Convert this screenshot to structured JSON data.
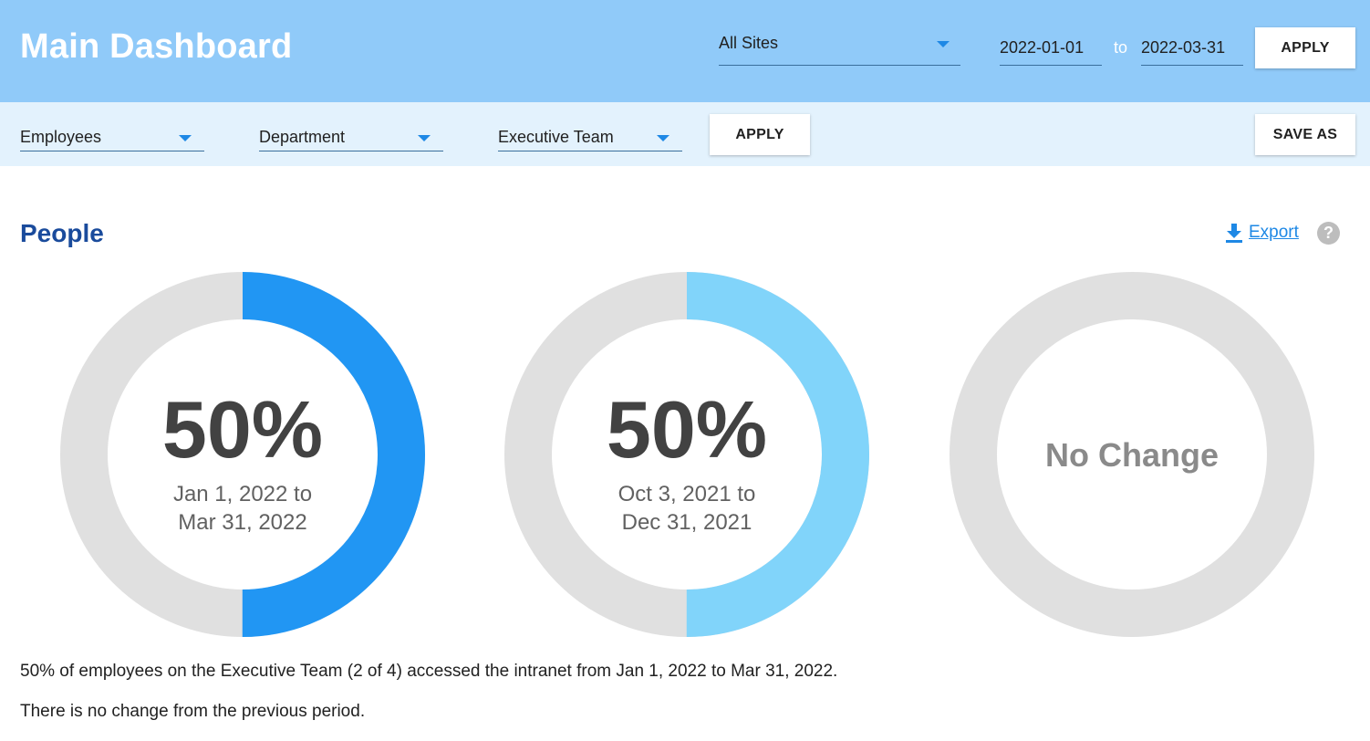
{
  "header": {
    "title": "Main Dashboard",
    "site_select": {
      "value": "All Sites"
    },
    "date_from": "2022-01-01",
    "to_label": "to",
    "date_to": "2022-03-31",
    "apply_label": "APPLY"
  },
  "filters": {
    "items": [
      {
        "value": "Employees"
      },
      {
        "value": "Department"
      },
      {
        "value": "Executive Team"
      }
    ],
    "apply_label": "APPLY",
    "save_as_label": "SAVE AS"
  },
  "section": {
    "title": "People",
    "export_label": "Export",
    "help_glyph": "?"
  },
  "donuts": [
    {
      "percent_label": "50%",
      "fill_fraction": 0.5,
      "color": "#2196f3",
      "range_line1": "Jan 1, 2022 to",
      "range_line2": "Mar 31, 2022"
    },
    {
      "percent_label": "50%",
      "fill_fraction": 0.5,
      "color": "#81d4fa",
      "range_line1": "Oct 3, 2021 to",
      "range_line2": "Dec 31, 2021"
    },
    {
      "label": "No Change",
      "fill_fraction": 0,
      "color": "#e0e0e0"
    }
  ],
  "summary": {
    "line1": "50% of employees on the Executive Team (2 of 4) accessed the intranet from Jan 1, 2022 to Mar 31, 2022.",
    "line2": "There is no change from the previous period."
  },
  "colors": {
    "header_bg": "#90caf9",
    "filterbar_bg": "#e3f2fd",
    "accent": "#1e88e5",
    "track": "#e0e0e0",
    "section_title": "#1a4b9c"
  },
  "icons": [
    "chevron-down-icon",
    "download-icon",
    "help-icon"
  ]
}
